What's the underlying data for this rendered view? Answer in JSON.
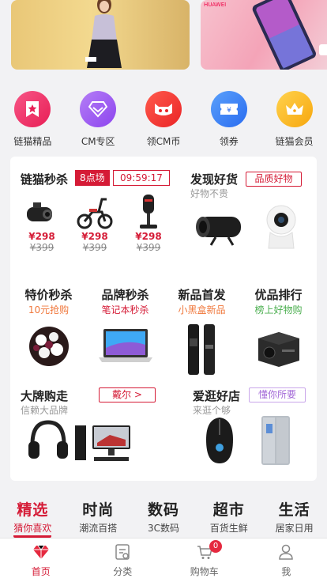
{
  "categories": [
    {
      "label": "链猫精品",
      "icon": "star-ribbon-icon",
      "color": "#f0366a"
    },
    {
      "label": "CM专区",
      "icon": "diamond-icon",
      "color": "#9b56f0"
    },
    {
      "label": "领CM币",
      "icon": "cat-face-icon",
      "color": "#f43f3b"
    },
    {
      "label": "领券",
      "icon": "yen-ticket-icon",
      "color": "#3c82f5"
    },
    {
      "label": "链猫会员",
      "icon": "crown-icon",
      "color": "#f8b319"
    }
  ],
  "flash_sale": {
    "title": "链猫秒杀",
    "session": "8点场",
    "countdown": "09:59:17",
    "items": [
      {
        "name": "dashcam",
        "price": "¥298",
        "old_price": "¥399"
      },
      {
        "name": "ebike",
        "price": "¥298",
        "old_price": "¥399"
      },
      {
        "name": "microphone",
        "price": "¥298",
        "old_price": "¥399"
      }
    ]
  },
  "discover": {
    "title": "发现好货",
    "subtitle": "好物不贵",
    "tag": "品质好物"
  },
  "grid": [
    {
      "title": "特价秒杀",
      "subtitle": "10元抢购",
      "color": "#f0783c"
    },
    {
      "title": "品牌秒杀",
      "subtitle": "笔记本秒杀",
      "color": "#d51b36"
    },
    {
      "title": "新品首发",
      "subtitle": "小黑盒新品",
      "color": "#f0783c"
    },
    {
      "title": "优品排行",
      "subtitle": "榜上好物购",
      "color": "#4caf50"
    }
  ],
  "brand_purchase": {
    "title": "大牌购走",
    "subtitle": "信赖大品牌",
    "tag": "戴尔 >"
  },
  "good_shop": {
    "title": "爱逛好店",
    "subtitle": "来逛个够",
    "tag": "懂你所要"
  },
  "channel_tabs": [
    {
      "title": "精选",
      "subtitle": "猜你喜欢",
      "active": true
    },
    {
      "title": "时尚",
      "subtitle": "潮流百搭",
      "active": false
    },
    {
      "title": "数码",
      "subtitle": "3C数码",
      "active": false
    },
    {
      "title": "超市",
      "subtitle": "百货生鲜",
      "active": false
    },
    {
      "title": "生活",
      "subtitle": "居家日用",
      "active": false
    }
  ],
  "nav": {
    "home": "首页",
    "category": "分类",
    "cart": "购物车",
    "cart_count": "0",
    "me": "我"
  },
  "banner_b_text": "HUAWEI"
}
